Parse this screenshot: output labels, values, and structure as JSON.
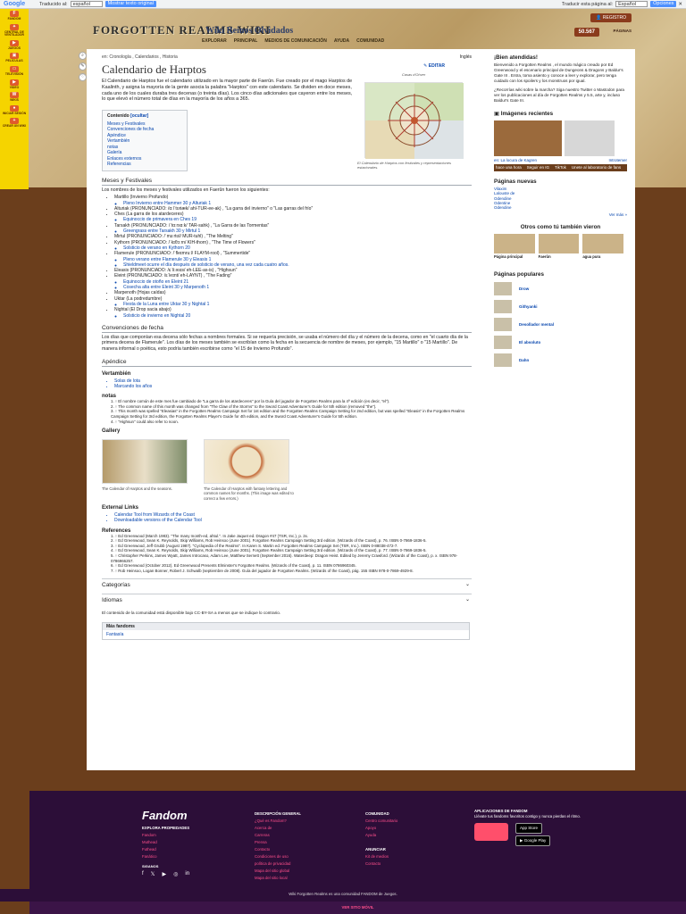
{
  "translate_bar": {
    "logo": "Google",
    "translated_to": "Traducido al:",
    "lang_selected": "español",
    "show_original": "Mostrar texto original",
    "translate_page": "Traducir esta página al:",
    "lang_selected_2": "Español",
    "options": "Opciones"
  },
  "left_sidebar": [
    {
      "label": "FANDOM",
      "icon": "F"
    },
    {
      "label": "CENTRAL DE VENTILADOR",
      "icon": "✦"
    },
    {
      "label": "JUEGOS",
      "icon": "▶"
    },
    {
      "label": "PELÍCULAS",
      "icon": "▣"
    },
    {
      "label": "TELEVISIÓN",
      "icon": "▭"
    },
    {
      "label": "VIDEO",
      "icon": "▶"
    },
    {
      "label": "WIKIS",
      "icon": "W"
    },
    {
      "label": "INICIAR SESIÓN",
      "icon": "●"
    },
    {
      "label": "CREAR UN WIKI",
      "icon": "+"
    }
  ],
  "header": {
    "logo": "FORGOTTEN REALMS WIKI",
    "wiki_title": "Wiki Reinos Olvidados",
    "nav": [
      "EXPLORAR",
      "PRINCIPAL",
      "MEDIOS DE COMUNICACIÓN",
      "AYUDA",
      "COMUNIDAD"
    ],
    "register": "REGISTRO",
    "pages_count": "50.567",
    "pages_label": "PÁGINAS"
  },
  "tools": [
    "⌕",
    "✎",
    "♡"
  ],
  "main": {
    "breadcrumbs": "en: Cronología , Calendarios , Historia",
    "lang": "Inglés",
    "title": "Calendario de Harptos",
    "edit": "EDITAR",
    "intro": "El Calendario de Harptos fue el calendario utilizado en la mayor parte de Faerûn. Fue creado por el mago Harptos de Kaalinth, y asigna la mayoría de la gente asocia la palabra \"Harptos\" con este calendario. Se dividen en doce meses, cada uno de los cuales duraba tres decenas (o treinta días). Los cinco días adicionales que cayeron entre los meses, lo que elevó el número total de días en la mayoría de los años a 365.",
    "infobox_label": "Casas d'Ohver",
    "infobox_caption": "El Calendario de Harptos con festivales y representaciones estacionales.",
    "toc_title": "Contenido",
    "toc_hide": "[ocultar]",
    "toc": [
      "Meses y Festivales",
      "Convenciones de fecha",
      "Apéndice",
      "Vertambién",
      "notas",
      "Galería",
      "Enlaces externos",
      "Referencias"
    ],
    "sec1": "Meses y Festivales",
    "sec1_intro": "Los nombres de los meses y festivales utilizados en Faerûn fueron los siguientes:",
    "months": [
      {
        "t": "Martillo (Invierno Profundo)",
        "sub": [
          "Pleno Invierno entre Hammer 30 y Alturiak 1"
        ]
      },
      {
        "t": "Alturiak (PRONUNCIADO: /ɑːlˈtʊriæk/ ahl-TUR-ee-ak) , \"La garra del invierno\" o \"Las garras del frío\"",
        "sub": []
      },
      {
        "t": "Ches (La garra de los atardeceres)",
        "sub": [
          "Equinoccio de primavera en Ches 19"
        ]
      },
      {
        "t": "Tarsakh (PRONUNCIADO: /ˈtɑːrsɑːk/ TAR-sahk) , \"La Garra de las Tormentas\"",
        "sub": [
          "Greengrass entre Tarsakh 30 y Mirtul 1"
        ]
      },
      {
        "t": "Mirtul (PRONUNCIADO: /ˈmɜːrtʊl/ MUR-tuhl) , \"The Melting\"",
        "sub": []
      },
      {
        "t": "Kythorn (PRONUNCIADO: /ˈkɪθɔːrn/ KIH-thorn) , \"The Time of Flowers\"",
        "sub": [
          "Solsticio de verano en Kythorn 20"
        ]
      },
      {
        "t": "Flamerule (PRONUNCIADO: /ˈfleɪmruːl/ FLAYM-rool) , \"Summertide\"",
        "sub": [
          "Pleno verano entre Flamerule 30 y Eleasis 1",
          "Shieldmeet ocurre el día después de solsticio de verano, una vez cada cuatro años."
        ]
      },
      {
        "t": "Eleasis (PRONUNCIADO: /ɛˈliːəsɪs/ eh-LEE-as-is) , \"Highsun\"",
        "sub": []
      },
      {
        "t": "Eleint (PRONUNCIADO: /ɛˈleɪnt/ eh-LAYNT) , \"The Fading\"",
        "sub": [
          "Equinoccio de otoño en Eleint 21",
          "Cosecha alta entre Eleint 30 y Marpenoth 1"
        ]
      },
      {
        "t": "Marpenoth (Hojas caídas)",
        "sub": []
      },
      {
        "t": "Uktar (La podredumbre)",
        "sub": [
          "Fiesta de la Luna entre Uktar 30 y Nightal 1"
        ]
      },
      {
        "t": "Nightal (El Drop sacia abajo)",
        "sub": [
          "Solsticio de invierno en Nightal 20"
        ]
      }
    ],
    "sec2": "Convenciones de fecha",
    "sec2_text": "Los días que componían esa decena sólo fechas a nombres formales. Si se requería precisión, se usaba el número del día y el número de la decena, como en \"el cuarto día de la primera decena de Flamerule\". Los días de los meses también se escribían como la fecha en la secuencia de nombre de meses, por ejemplo, \"15 Martillo\" o \"15 Martillo\". De manera informal o poética, esto podría también escribirse como \"el 15 de Invierno Profundo\".",
    "sec3": "Apéndice",
    "sec3a": "Vertambién",
    "see_also": [
      "Solas de lota",
      "Marcando los años"
    ],
    "sec3b": "notas",
    "notes": [
      "1. ↑ El nombre común de este mes fue cambiado de \"La garra de los atardeceres\" por la Guía del jugador de Forgotten Realms para la 4ª edición (es decir, \"el\").",
      "2. ↑ The common name of this month was changed from \"The Claw of the Storms\" to the Sword Coast Adventurer's Guide for 5th edition (removed \"the\").",
      "3. ↑ This month was spelled \"Eleasias\" in the Forgotten Realms Campaign Set for 1st edition and the Forgotten Realms Campaign Setting for 2nd edition, but was spelled \"Eleasis\" in the Forgotten Realms Campaign Setting for 3rd edition, the Forgotten Realms Player's Guide for 4th edition, and the Sword Coast Adventurer's Guide for 5th edition.",
      "4. ↑ \"Highsun\" could also refer to noon."
    ],
    "sec4": "Gallery",
    "gallery": [
      "The Calendar of Harptos and the seasons.",
      "The Calendar of Harptos with fantasy lettering and common names for months. (This image was edited to correct a few errors.)"
    ],
    "sec5": "External Links",
    "links": [
      "Calendar Tool from Wizards of the Coast",
      "Downloadable versions of the Calendar Tool"
    ],
    "sec6": "References",
    "refs": [
      "1. ↑ Ed Greenwood (March 1983). \"The many month-ed, ahtul.\". In Jake Jaquet ed. Dragon #47 (TSR, Inc.), p. 2x.",
      "2. ↑ Ed Greenwood, Sean K. Reynolds, Skip Williams, Rob Heinsoo (June 2001). Forgotten Realms Campaign Setting 3rd edition. (Wizards of the Coast), p. 76. ISBN 0-7869-1836-5.",
      "3. ↑ Ed Greenwood, Jeff Grubb (August 1987). \"Cyclopedia of the Realms\". In Karen S. Martin ed. Forgotten Realms Campaign Set (TSR, Inc.). ISBN 0-88038-472-7.",
      "4. ↑ Ed Greenwood, Sean K. Reynolds, Skip Williams, Rob Heinsoo (June 2001). Forgotten Realms Campaign Setting 3rd edition. (Wizards of the Coast), p. 77. ISBN 0-7869-1836-5.",
      "5. ↑ Christopher Perkins, James Wyatt, James Introcaso, Adam Lee, Matthew Sernett (September 2016). Waterdeep: Dragon Heist. Edited by Jeremy Crawford. (Wizards of the Coast), p. x. ISBN 978-0786966257.",
      "6. ↑ Ed Greenwood (October 2012). Ed Greenwood Presents Elminster's Forgotten Realms. (Wizards of the Coast), p. 11. ISBN 0786960345.",
      "7. ↑ Rob Heinsoo, Logan Bonner, Robert J. Schwalb (septiembre de 2008). Guía del jugador de Forgotten Realms. (Wizards of the Coast), pág. 155 ISBN 978-0-7869-4929-8."
    ],
    "categories": "Categorías",
    "languages": "Idiomas",
    "license": "El contenido de la comunidad está disponible bajo CC-BY-SA a menos que se indique lo contrario.",
    "fandom_box_h": "Más fandoms",
    "fandom_box_b": "Fantasía"
  },
  "right": {
    "welcome_h": "¡Bien atendidas!",
    "welcome": "Bienvenido a Forgotten Realms , el mundo mágico creado por Ed Greenwood y el escenario principal de Dungeons & Dragons y Baldur's Gate III . Entra, toma asiento y conoce a leer y explorar, pero tenga cuidado con los spoilers y los monstruos por igual.",
    "join": "¿Recorrías wiki sobre la marcha? Siga nuestro Twitter o Mastodon para ver los publicaciones al día de Forgotten Realms y 5.5, arte y, incluso Baldur's Gate III.",
    "images_h": "Imágenes recientes",
    "img_caption": "en: La locura de Kagren",
    "img_caption2": "Introtemer",
    "img_time": "hace una hora",
    "new_pages_h": "Páginas nuevas",
    "new_pages": [
      "Vilaxim",
      "Lalouste de",
      "Odendine",
      "Odentine",
      "Odendine"
    ],
    "see_more": "Ver más »",
    "others_h": "Otros como tú también vieron",
    "others": [
      "Página principal",
      "Faerûn",
      "agua pura"
    ],
    "popular_h": "Páginas populares",
    "popular": [
      "Drow",
      "Githyanki",
      "Desollador mental",
      "El absoluto",
      "Dahn"
    ],
    "follow": [
      "Seguir en IG",
      "TikTok",
      "Unete al laboratorio de fans"
    ]
  },
  "footer": {
    "logo": "Fandom",
    "explore_h": "EXPLORA PROPIEDADES",
    "explore": [
      "Fandom",
      "Muthead",
      "Futhead",
      "Fanático"
    ],
    "follow": "SIGANOS",
    "social": [
      "f",
      "𝕏",
      "▶",
      "◎",
      "in"
    ],
    "desc_h": "DESCRIPCIÓN GENERAL",
    "desc": [
      "¿Qué es Fandom?",
      "Acerca de",
      "Carreras",
      "Prensa",
      "Contacto",
      "Condiciones de uso",
      "política de privacidad",
      "Mapa del sitio global",
      "Mapa del sitio local"
    ],
    "comm_h": "COMUNIDAD",
    "comm": [
      "Centro comunitario",
      "Apoyo",
      "Ayuda"
    ],
    "ads_h": "ANUNCIAR",
    "ads": [
      "Kit de medios",
      "Contacto"
    ],
    "apps_h": "APLICACIONES DE FANDOM",
    "apps": "Llévate tus fandoms favoritos contigo y nunca pierdas el ritmo.",
    "appstore": "App Store",
    "googleplay": "Google Play",
    "bottom": "Wiki Forgotten Realms es una comunidad FANDOM de Juegos.",
    "mobile": "VER SITIO MÓVIL"
  },
  "colors": {
    "accent": "#f5d400",
    "brand": "#2c0e38",
    "link": "#0645ad",
    "footer_link": "#ff4f8b"
  }
}
